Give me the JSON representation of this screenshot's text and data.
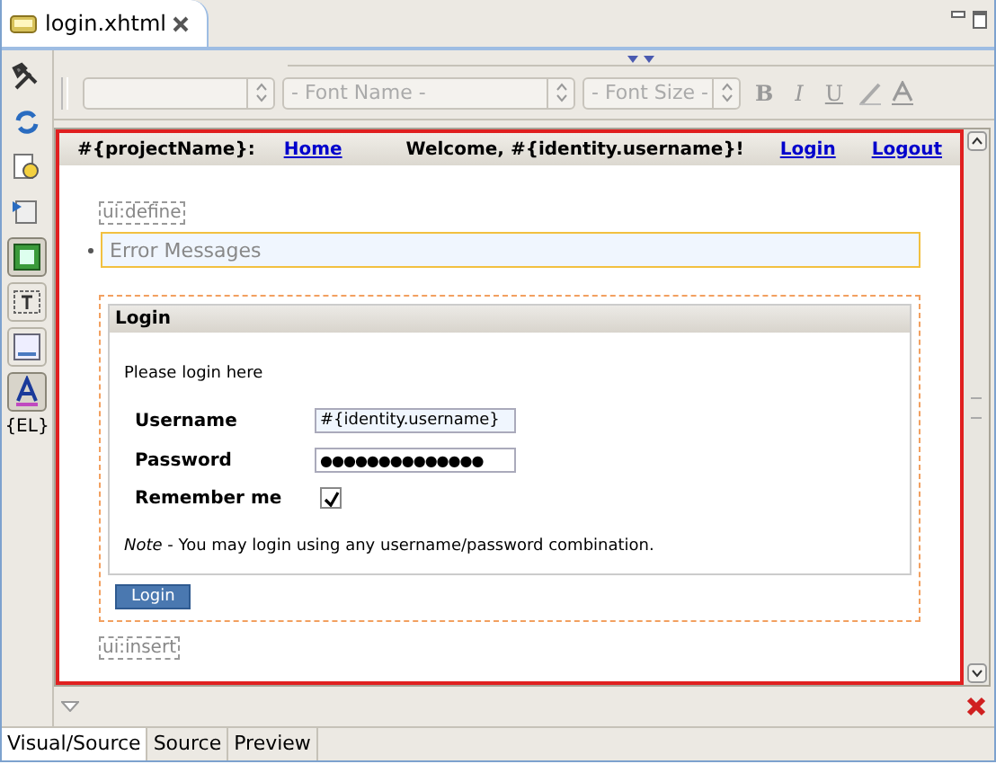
{
  "editor_tab": {
    "title": "login.xhtml"
  },
  "palette": [
    {
      "kind": "tools"
    },
    {
      "kind": "refresh"
    },
    {
      "kind": "find"
    },
    {
      "kind": "pin"
    },
    {
      "kind": "image",
      "selected": true
    },
    {
      "kind": "textbox",
      "selected": false
    },
    {
      "kind": "panel",
      "selected": false
    },
    {
      "kind": "font",
      "selected": true
    },
    {
      "kind": "el",
      "label": "{EL}"
    }
  ],
  "toolbar": {
    "combos": [
      {
        "kind": "style"
      },
      {
        "kind": "font",
        "placeholder": "- Font Name -"
      },
      {
        "kind": "size",
        "placeholder": "- Font Size -"
      }
    ],
    "format_buttons": [
      {
        "label": "B",
        "kind": "bold"
      },
      {
        "label": "I",
        "kind": "italic"
      },
      {
        "label": "U",
        "kind": "underline"
      }
    ]
  },
  "page": {
    "header": {
      "project": "#{projectName}:",
      "home_link": "Home",
      "welcome": "Welcome, #{identity.username}!",
      "links": [
        "Login",
        "Logout"
      ]
    },
    "define_tag": "ui:define",
    "error_messages": "Error Messages",
    "panel": {
      "title": "Login",
      "intro": "Please login here",
      "fields": [
        {
          "label": "Username",
          "kind": "text",
          "value": "#{identity.username}"
        },
        {
          "label": "Password",
          "kind": "password",
          "value": "●●●●●●●●●●●●●●"
        },
        {
          "label": "Remember me",
          "kind": "checkbox",
          "checked": true
        }
      ],
      "note": "*Note* - You may login using any username/password combination."
    },
    "submit": "Login",
    "insert_tag": "ui:insert"
  },
  "view_tabs": [
    {
      "label": "Visual/Source",
      "selected": true
    },
    {
      "label": "Source",
      "selected": false
    },
    {
      "label": "Preview",
      "selected": false
    }
  ]
}
